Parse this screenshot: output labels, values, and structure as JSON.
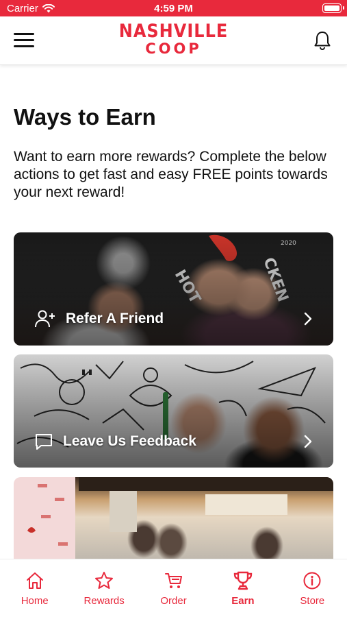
{
  "status_bar": {
    "carrier": "Carrier",
    "time": "4:59 PM"
  },
  "header": {
    "logo_line1": "NASHVILLE",
    "logo_line2": "COOP",
    "menu_icon": "hamburger-menu-icon",
    "notification_icon": "bell-icon"
  },
  "main": {
    "title": "Ways to Earn",
    "intro": "Want to earn more rewards? Complete the below actions to get fast and easy FREE points towards your next reward!",
    "cards": [
      {
        "label": "Refer A Friend",
        "icon": "add-user-icon"
      },
      {
        "label": "Leave Us Feedback",
        "icon": "chat-bubble-icon"
      },
      {
        "label": "",
        "icon": ""
      }
    ]
  },
  "tab_bar": {
    "items": [
      {
        "label": "Home",
        "icon": "home-icon",
        "active": false
      },
      {
        "label": "Rewards",
        "icon": "star-icon",
        "active": false
      },
      {
        "label": "Order",
        "icon": "cart-icon",
        "active": false
      },
      {
        "label": "Earn",
        "icon": "trophy-icon",
        "active": true
      },
      {
        "label": "Store",
        "icon": "info-icon",
        "active": false
      }
    ]
  },
  "colors": {
    "brand_red": "#e8293c",
    "text": "#111111",
    "background": "#ffffff"
  }
}
